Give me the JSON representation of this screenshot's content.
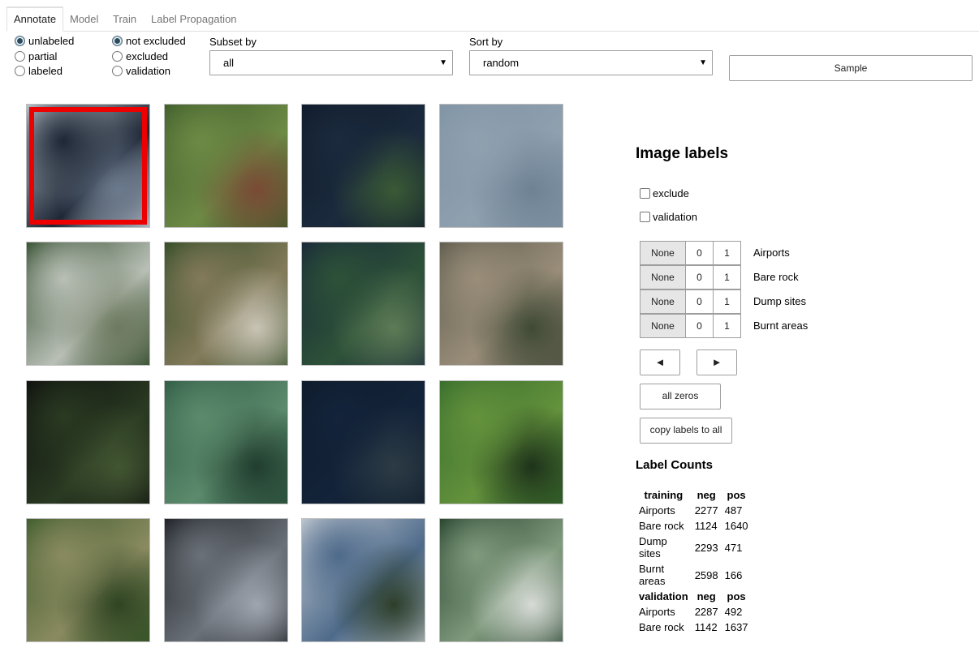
{
  "tabs": [
    {
      "label": "Annotate",
      "active": true
    },
    {
      "label": "Model",
      "active": false
    },
    {
      "label": "Train",
      "active": false
    },
    {
      "label": "Label Propagation",
      "active": false
    }
  ],
  "filters": {
    "label_status": [
      {
        "label": "unlabeled",
        "checked": true
      },
      {
        "label": "partial",
        "checked": false
      },
      {
        "label": "labeled",
        "checked": false
      }
    ],
    "exclusion": [
      {
        "label": "not excluded",
        "checked": true
      },
      {
        "label": "excluded",
        "checked": false
      },
      {
        "label": "validation",
        "checked": false
      }
    ],
    "subset_by": {
      "label": "Subset by",
      "value": "all"
    },
    "sort_by": {
      "label": "Sort by",
      "value": "random"
    },
    "sample_label": "Sample"
  },
  "thumbnails": [
    {
      "id": "t1",
      "selected": true,
      "colors": [
        "#c4ccd3",
        "#1e2736",
        "#6b7a8d"
      ]
    },
    {
      "id": "t2",
      "selected": false,
      "colors": [
        "#3e5c2b",
        "#6d8a45",
        "#7a4a35"
      ]
    },
    {
      "id": "t3",
      "selected": false,
      "colors": [
        "#0f1a2b",
        "#1b2a3d",
        "#3a5a35"
      ]
    },
    {
      "id": "t4",
      "selected": false,
      "colors": [
        "#7f93a4",
        "#8fa0af",
        "#6f8294"
      ]
    },
    {
      "id": "t5",
      "selected": false,
      "colors": [
        "#2e4a2a",
        "#b9bfb6",
        "#6e7a60"
      ]
    },
    {
      "id": "t6",
      "selected": false,
      "colors": [
        "#2f4a24",
        "#837a5a",
        "#c9c4b5"
      ]
    },
    {
      "id": "t7",
      "selected": false,
      "colors": [
        "#18283a",
        "#2d5238",
        "#5d7b55"
      ]
    },
    {
      "id": "t8",
      "selected": false,
      "colors": [
        "#5d5a4c",
        "#9a8e7a",
        "#3f4a35"
      ]
    },
    {
      "id": "t9",
      "selected": false,
      "colors": [
        "#0d0e0d",
        "#2a3a22",
        "#425632"
      ]
    },
    {
      "id": "t10",
      "selected": false,
      "colors": [
        "#2f5a44",
        "#5b8a6c",
        "#213d2e"
      ]
    },
    {
      "id": "t11",
      "selected": false,
      "colors": [
        "#0e1b2a",
        "#13233a",
        "#2c3b44"
      ]
    },
    {
      "id": "t12",
      "selected": false,
      "colors": [
        "#356b2c",
        "#64923c",
        "#1e331a"
      ]
    },
    {
      "id": "t13",
      "selected": false,
      "colors": [
        "#3b5b2a",
        "#8a8a60",
        "#2e4422"
      ]
    },
    {
      "id": "t14",
      "selected": false,
      "colors": [
        "#1a1d22",
        "#6b7179",
        "#a0a6b0"
      ]
    },
    {
      "id": "t15",
      "selected": false,
      "colors": [
        "#c5ccd4",
        "#4e6a8a",
        "#2d3f2a"
      ]
    },
    {
      "id": "t16",
      "selected": false,
      "colors": [
        "#24402a",
        "#7f9a7d",
        "#d7dbd6"
      ]
    }
  ],
  "image_labels": {
    "title": "Image labels",
    "exclude_label": "exclude",
    "validation_label": "validation",
    "toggle_options": [
      "None",
      "0",
      "1"
    ],
    "classes": [
      {
        "name": "Airports",
        "selected": "None"
      },
      {
        "name": "Bare rock",
        "selected": "None"
      },
      {
        "name": "Dump sites",
        "selected": "None"
      },
      {
        "name": "Burnt areas",
        "selected": "None"
      }
    ],
    "prev_label": "◄",
    "next_label": "►",
    "all_zeros_label": "all zeros",
    "copy_label": "copy labels to all"
  },
  "label_counts": {
    "title": "Label Counts",
    "training": {
      "headers": [
        "training",
        "neg",
        "pos"
      ],
      "rows": [
        [
          "Airports",
          "2277",
          "487"
        ],
        [
          "Bare rock",
          "1124",
          "1640"
        ],
        [
          "Dump sites",
          "2293",
          "471"
        ],
        [
          "Burnt areas",
          "2598",
          "166"
        ]
      ]
    },
    "validation": {
      "headers": [
        "validation",
        "neg",
        "pos"
      ],
      "rows": [
        [
          "Airports",
          "2287",
          "492"
        ],
        [
          "Bare rock",
          "1142",
          "1637"
        ]
      ]
    }
  }
}
